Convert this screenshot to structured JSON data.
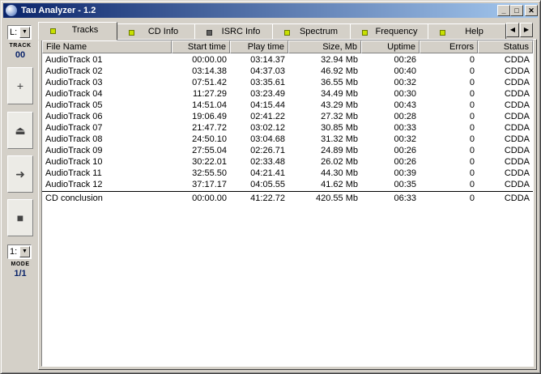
{
  "window": {
    "title": "Tau Analyzer - 1.2"
  },
  "titlebar_buttons": {
    "minimize": "_",
    "maximize": "□",
    "close": "✕"
  },
  "leftbar": {
    "drive_value": "L:",
    "track_label": "TRACK",
    "track_number": "00",
    "buttons": [
      {
        "name": "add",
        "icon": "plus-icon",
        "glyph": "+"
      },
      {
        "name": "eject",
        "icon": "eject-icon",
        "glyph": "⏏"
      },
      {
        "name": "play",
        "icon": "arrow-right-icon",
        "glyph": "➜"
      },
      {
        "name": "stop",
        "icon": "stop-icon",
        "glyph": "■"
      }
    ],
    "mode_value": "1:",
    "mode_label": "MODE",
    "mode_number": "1/1"
  },
  "tabs": [
    {
      "label": "Tracks",
      "led": "green",
      "active": true
    },
    {
      "label": "CD Info",
      "led": "green",
      "active": false
    },
    {
      "label": "ISRC Info",
      "led": "grey",
      "active": false
    },
    {
      "label": "Spectrum",
      "led": "green",
      "active": false
    },
    {
      "label": "Frequency",
      "led": "green",
      "active": false
    },
    {
      "label": "Help",
      "led": "green",
      "active": false
    }
  ],
  "table": {
    "columns": [
      "File Name",
      "Start time",
      "Play time",
      "Size, Mb",
      "Uptime",
      "Errors",
      "Status"
    ],
    "rows": [
      [
        "AudioTrack 01",
        "00:00.00",
        "03:14.37",
        "32.94 Mb",
        "00:26",
        "0",
        "CDDA"
      ],
      [
        "AudioTrack 02",
        "03:14.38",
        "04:37.03",
        "46.92 Mb",
        "00:40",
        "0",
        "CDDA"
      ],
      [
        "AudioTrack 03",
        "07:51.42",
        "03:35.61",
        "36.55 Mb",
        "00:32",
        "0",
        "CDDA"
      ],
      [
        "AudioTrack 04",
        "11:27.29",
        "03:23.49",
        "34.49 Mb",
        "00:30",
        "0",
        "CDDA"
      ],
      [
        "AudioTrack 05",
        "14:51.04",
        "04:15.44",
        "43.29 Mb",
        "00:43",
        "0",
        "CDDA"
      ],
      [
        "AudioTrack 06",
        "19:06.49",
        "02:41.22",
        "27.32 Mb",
        "00:28",
        "0",
        "CDDA"
      ],
      [
        "AudioTrack 07",
        "21:47.72",
        "03:02.12",
        "30.85 Mb",
        "00:33",
        "0",
        "CDDA"
      ],
      [
        "AudioTrack 08",
        "24:50.10",
        "03:04.68",
        "31.32 Mb",
        "00:32",
        "0",
        "CDDA"
      ],
      [
        "AudioTrack 09",
        "27:55.04",
        "02:26.71",
        "24.89 Mb",
        "00:26",
        "0",
        "CDDA"
      ],
      [
        "AudioTrack 10",
        "30:22.01",
        "02:33.48",
        "26.02 Mb",
        "00:26",
        "0",
        "CDDA"
      ],
      [
        "AudioTrack 11",
        "32:55.50",
        "04:21.41",
        "44.30 Mb",
        "00:39",
        "0",
        "CDDA"
      ],
      [
        "AudioTrack 12",
        "37:17.17",
        "04:05.55",
        "41.62 Mb",
        "00:35",
        "0",
        "CDDA"
      ]
    ],
    "summary": [
      "CD conclusion",
      "00:00.00",
      "41:22.72",
      "420.55 Mb",
      "06:33",
      "0",
      "CDDA"
    ]
  }
}
